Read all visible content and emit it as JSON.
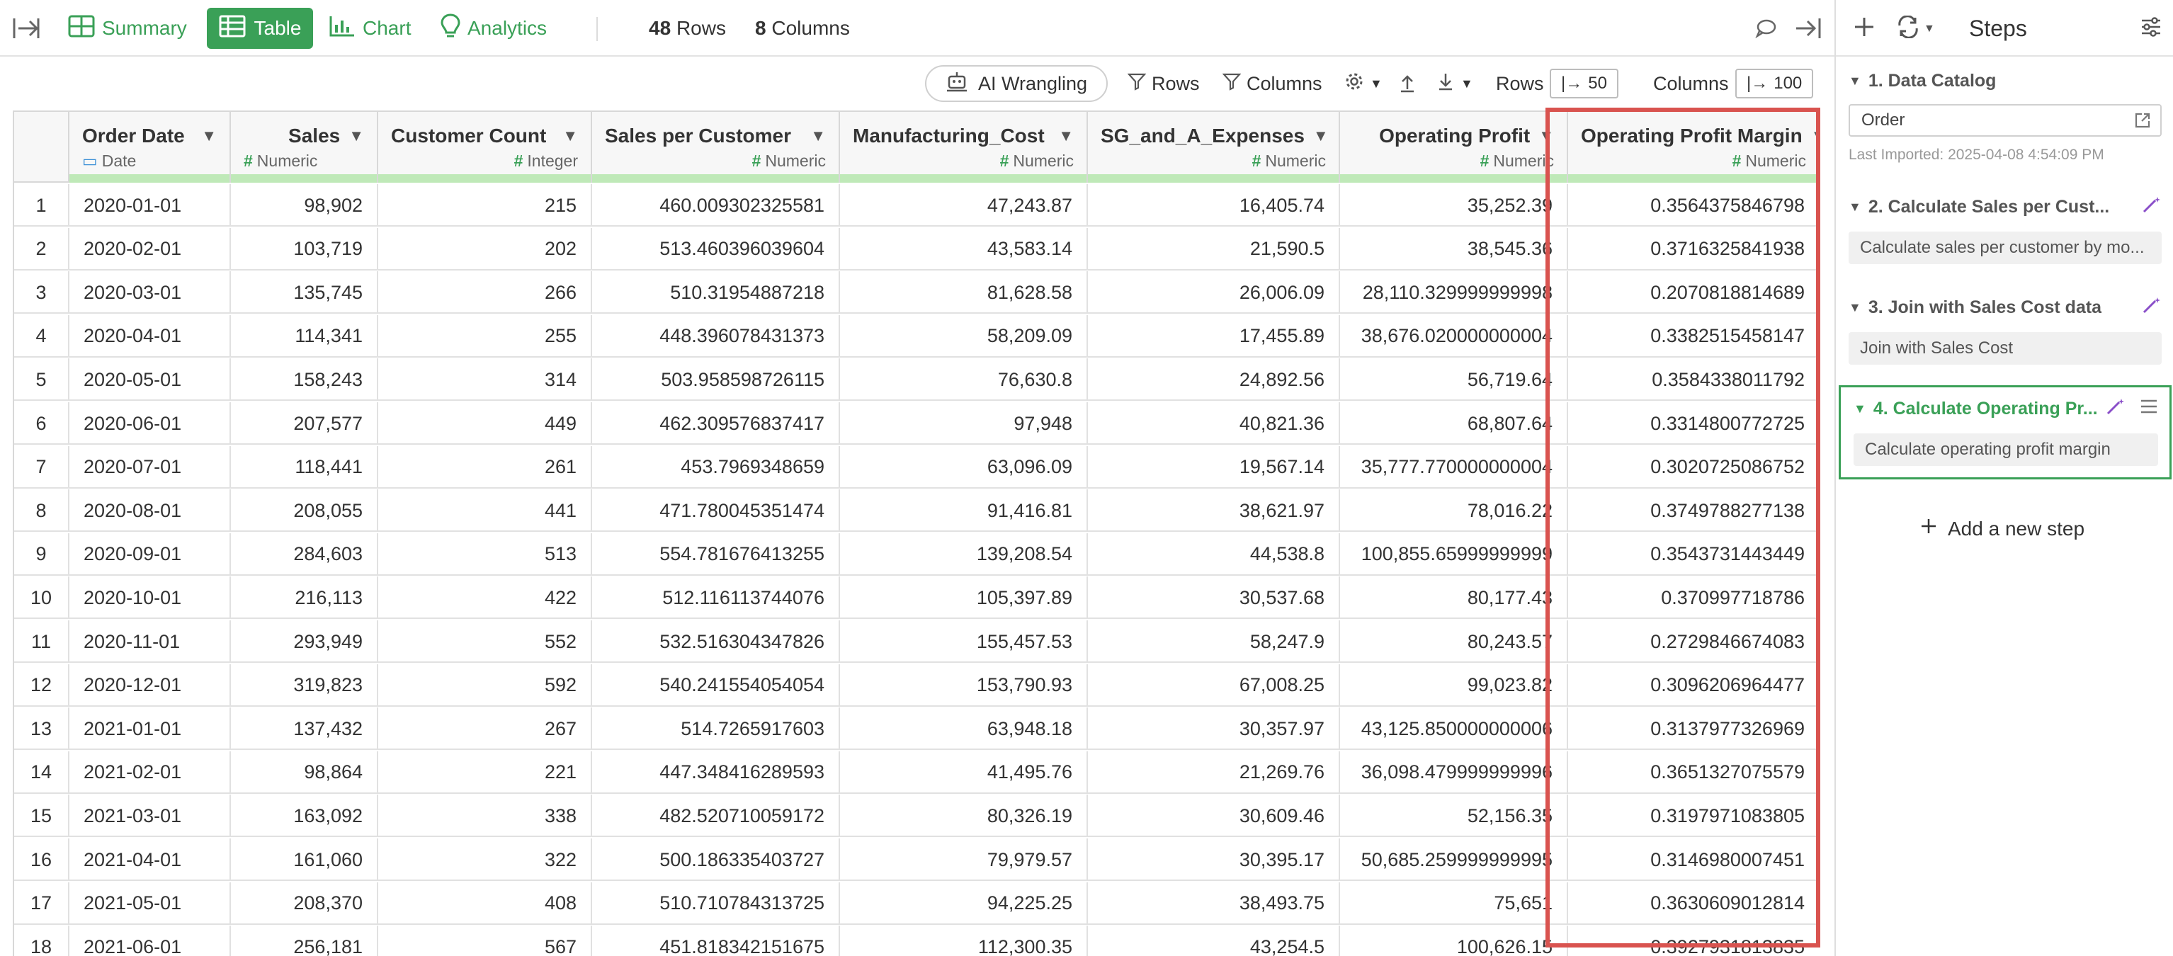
{
  "toolbar": {
    "tabs": [
      {
        "label": "Summary",
        "icon": "summary-grid-icon"
      },
      {
        "label": "Table",
        "icon": "table-icon",
        "active": true
      },
      {
        "label": "Chart",
        "icon": "bar-chart-icon"
      },
      {
        "label": "Analytics",
        "icon": "lightbulb-icon"
      }
    ],
    "rows_count": "48",
    "rows_word": "Rows",
    "cols_count": "8",
    "cols_word": "Columns"
  },
  "table_toolbar": {
    "ai_label": "AI Wrangling",
    "rows_filter": "Rows",
    "columns_filter": "Columns",
    "rows_label": "Rows",
    "rows_value": "50",
    "columns_label": "Columns",
    "columns_value": "100"
  },
  "columns": [
    {
      "name": "Order Date",
      "type": "Date"
    },
    {
      "name": "Sales",
      "type": "Numeric"
    },
    {
      "name": "Customer Count",
      "type": "Integer"
    },
    {
      "name": "Sales per Customer",
      "type": "Numeric"
    },
    {
      "name": "Manufacturing_Cost",
      "type": "Numeric"
    },
    {
      "name": "SG_and_A_Expenses",
      "type": "Numeric"
    },
    {
      "name": "Operating Profit",
      "type": "Numeric"
    },
    {
      "name": "Operating Profit Margin",
      "type": "Numeric"
    }
  ],
  "rows": [
    [
      "1",
      "2020-01-01",
      "98,902",
      "215",
      "460.009302325581",
      "47,243.87",
      "16,405.74",
      "35,252.39",
      "0.3564375846798"
    ],
    [
      "2",
      "2020-02-01",
      "103,719",
      "202",
      "513.460396039604",
      "43,583.14",
      "21,590.5",
      "38,545.36",
      "0.3716325841938"
    ],
    [
      "3",
      "2020-03-01",
      "135,745",
      "266",
      "510.31954887218",
      "81,628.58",
      "26,006.09",
      "28,110.329999999998",
      "0.2070818814689"
    ],
    [
      "4",
      "2020-04-01",
      "114,341",
      "255",
      "448.396078431373",
      "58,209.09",
      "17,455.89",
      "38,676.020000000004",
      "0.3382515458147"
    ],
    [
      "5",
      "2020-05-01",
      "158,243",
      "314",
      "503.958598726115",
      "76,630.8",
      "24,892.56",
      "56,719.64",
      "0.3584338011792"
    ],
    [
      "6",
      "2020-06-01",
      "207,577",
      "449",
      "462.309576837417",
      "97,948",
      "40,821.36",
      "68,807.64",
      "0.3314800772725"
    ],
    [
      "7",
      "2020-07-01",
      "118,441",
      "261",
      "453.7969348659",
      "63,096.09",
      "19,567.14",
      "35,777.770000000004",
      "0.3020725086752"
    ],
    [
      "8",
      "2020-08-01",
      "208,055",
      "441",
      "471.780045351474",
      "91,416.81",
      "38,621.97",
      "78,016.22",
      "0.3749788277138"
    ],
    [
      "9",
      "2020-09-01",
      "284,603",
      "513",
      "554.781676413255",
      "139,208.54",
      "44,538.8",
      "100,855.65999999999",
      "0.3543731443449"
    ],
    [
      "10",
      "2020-10-01",
      "216,113",
      "422",
      "512.116113744076",
      "105,397.89",
      "30,537.68",
      "80,177.43",
      "0.370997718786"
    ],
    [
      "11",
      "2020-11-01",
      "293,949",
      "552",
      "532.516304347826",
      "155,457.53",
      "58,247.9",
      "80,243.57",
      "0.2729846674083"
    ],
    [
      "12",
      "2020-12-01",
      "319,823",
      "592",
      "540.241554054054",
      "153,790.93",
      "67,008.25",
      "99,023.82",
      "0.3096206964477"
    ],
    [
      "13",
      "2021-01-01",
      "137,432",
      "267",
      "514.7265917603",
      "63,948.18",
      "30,357.97",
      "43,125.850000000006",
      "0.3137977326969"
    ],
    [
      "14",
      "2021-02-01",
      "98,864",
      "221",
      "447.348416289593",
      "41,495.76",
      "21,269.76",
      "36,098.479999999996",
      "0.3651327075579"
    ],
    [
      "15",
      "2021-03-01",
      "163,092",
      "338",
      "482.520710059172",
      "80,326.19",
      "30,609.46",
      "52,156.35",
      "0.3197971083805"
    ],
    [
      "16",
      "2021-04-01",
      "161,060",
      "322",
      "500.186335403727",
      "79,979.57",
      "30,395.17",
      "50,685.259999999995",
      "0.3146980007451"
    ],
    [
      "17",
      "2021-05-01",
      "208,370",
      "408",
      "510.710784313725",
      "94,225.25",
      "38,493.75",
      "75,651",
      "0.3630609012814"
    ],
    [
      "18",
      "2021-06-01",
      "256,181",
      "567",
      "451.818342151675",
      "112,300.35",
      "43,254.5",
      "100,626.15",
      "0.3927931813835"
    ]
  ],
  "steps_panel": {
    "title": "Steps",
    "steps": [
      {
        "title": "1. Data Catalog",
        "body": "Order",
        "meta": "Last Imported: 2025-04-08 4:54:09 PM"
      },
      {
        "title": "2. Calculate Sales per Cust...",
        "body": "Calculate sales per customer by mo..."
      },
      {
        "title": "3. Join with Sales Cost data",
        "body": "Join with Sales Cost"
      },
      {
        "title": "4. Calculate Operating Pr...",
        "body": "Calculate operating profit margin",
        "active": true
      }
    ],
    "add_step": "Add a new step"
  },
  "colors": {
    "accent": "#3aa057",
    "highlight": "#d9534f",
    "ai_purple": "#8a4fc9"
  }
}
